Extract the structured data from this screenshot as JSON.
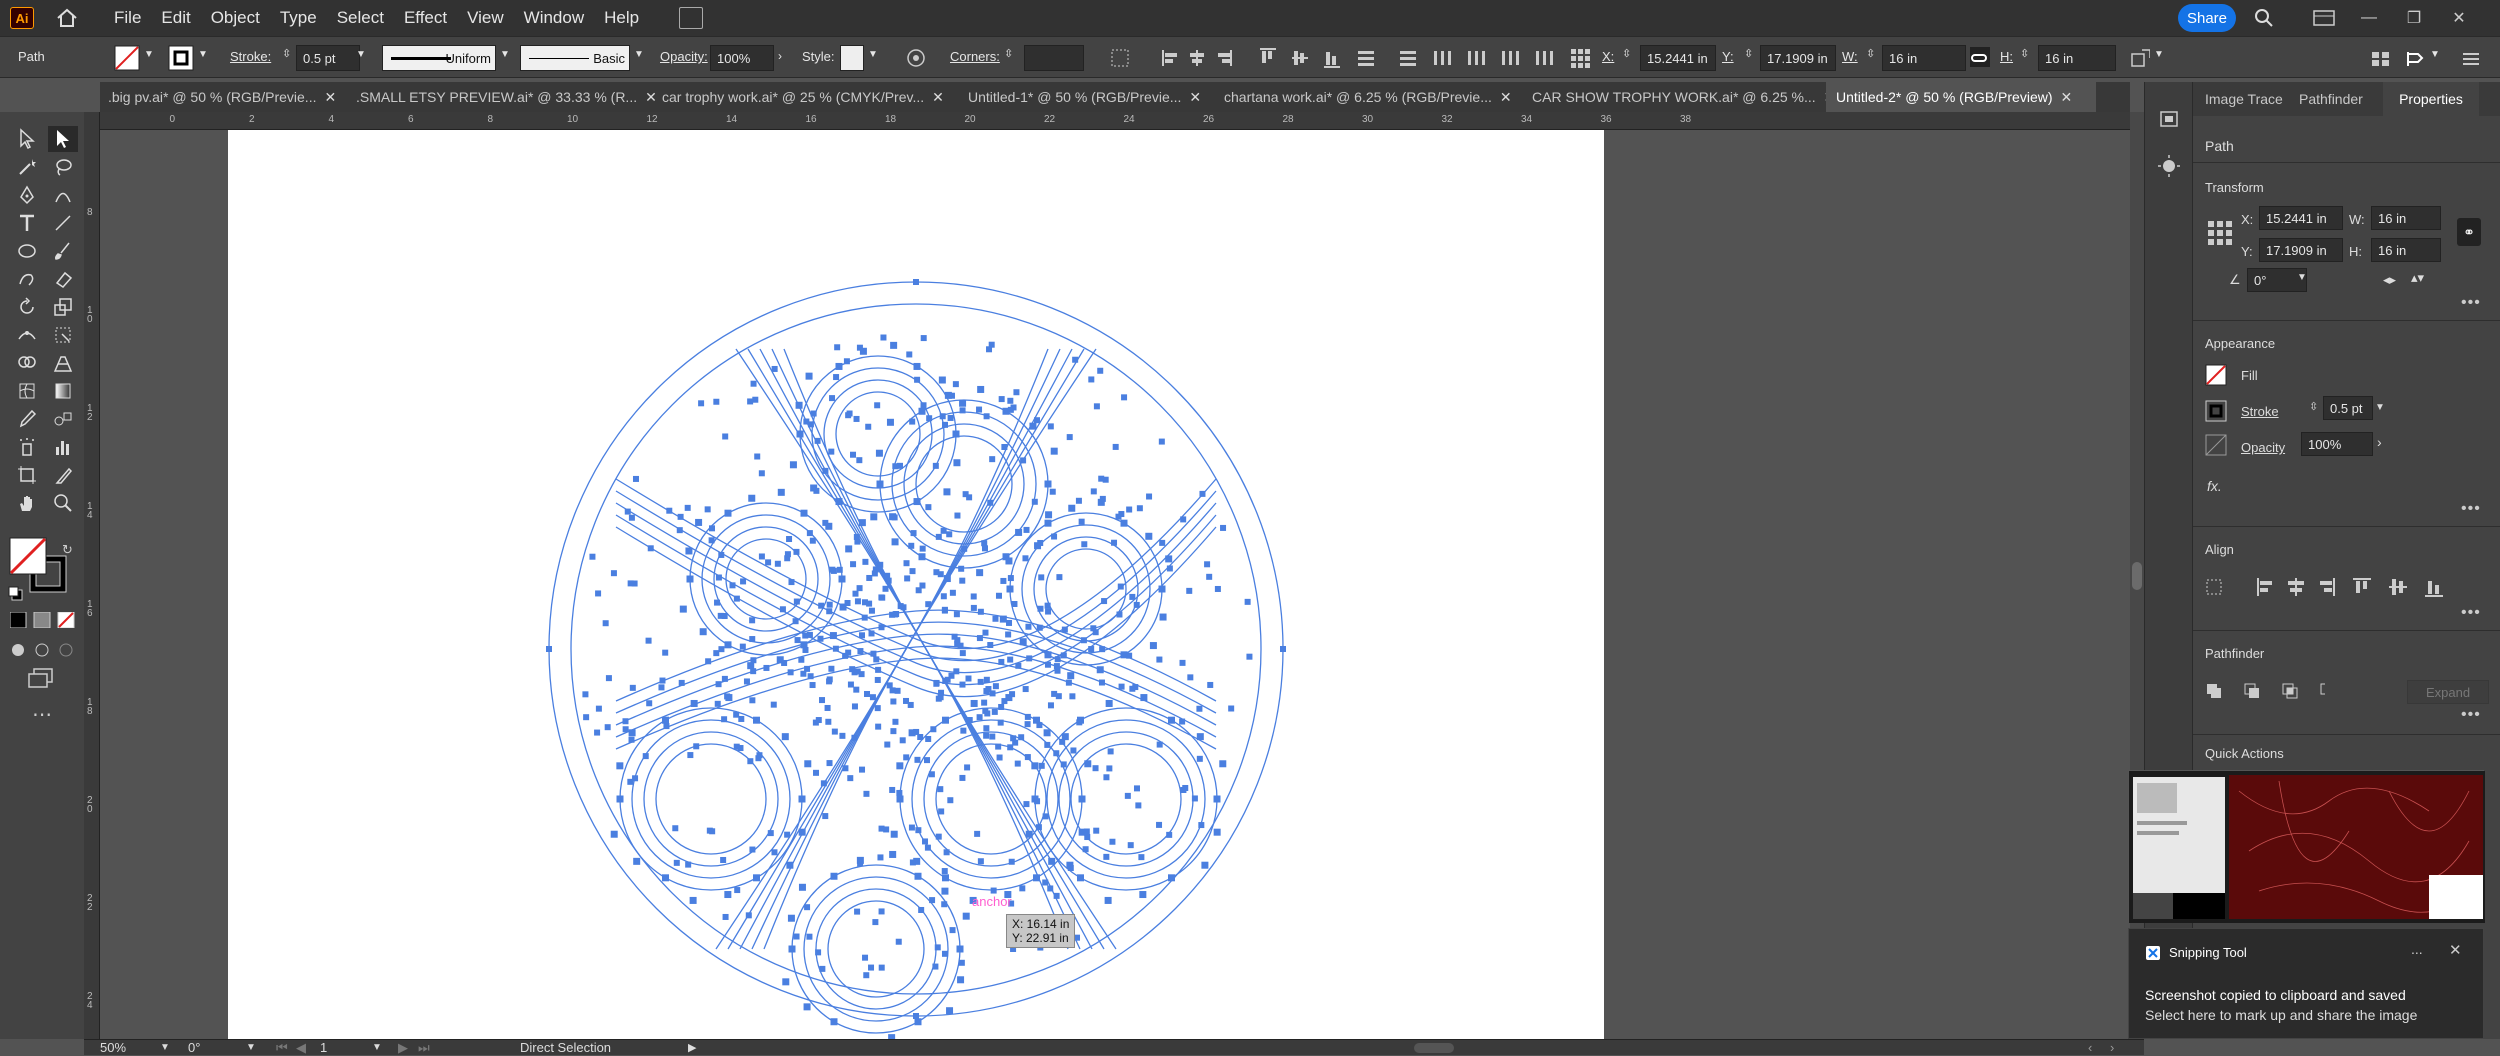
{
  "app": {
    "logo_text": "Ai",
    "share_label": "Share"
  },
  "menu": [
    "File",
    "Edit",
    "Object",
    "Type",
    "Select",
    "Effect",
    "View",
    "Window",
    "Help"
  ],
  "control": {
    "object_type": "Path",
    "stroke_label": "Stroke:",
    "stroke_weight": "0.5 pt",
    "profile_uniform": "Uniform",
    "brush_basic": "Basic",
    "opacity_label": "Opacity:",
    "opacity_value": "100%",
    "style_label": "Style:",
    "corners_label": "Corners:",
    "x_label": "X:",
    "x_value": "15.2441 in",
    "y_label": "Y:",
    "y_value": "17.1909 in",
    "w_label": "W:",
    "w_value": "16 in",
    "h_label": "H:",
    "h_value": "16 in"
  },
  "tabs": [
    {
      "label": ".big pv.ai* @ 50 % (RGB/Previe...",
      "active": false
    },
    {
      "label": ".SMALL ETSY PREVIEW.ai* @ 33.33 % (R...",
      "active": false
    },
    {
      "label": "car trophy work.ai* @ 25 % (CMYK/Prev...",
      "active": false
    },
    {
      "label": "Untitled-1* @ 50 % (RGB/Previe...",
      "active": false
    },
    {
      "label": "chartana work.ai* @ 6.25 % (RGB/Previe...",
      "active": false
    },
    {
      "label": "CAR SHOW TROPHY WORK.ai* @ 6.25 %...",
      "active": false
    },
    {
      "label": "Untitled-2* @ 50 % (RGB/Preview)",
      "active": true
    }
  ],
  "ruler": {
    "h_ticks": [
      "2",
      "0",
      "2",
      "4",
      "6",
      "8",
      "10",
      "12",
      "14",
      "16",
      "18",
      "20",
      "22",
      "24",
      "26",
      "28",
      "30",
      "32",
      "34",
      "36",
      "38"
    ],
    "v_ticks": [
      "8",
      "1 0",
      "1 2",
      "1 4",
      "1 6",
      "1 8",
      "2 0",
      "2 2",
      "2 4"
    ]
  },
  "canvas": {
    "cursor_label": "anchor",
    "tooltip_x": "X: 16.14 in",
    "tooltip_y": "Y: 22.91 in"
  },
  "panel": {
    "tabs": [
      "Image Trace",
      "Pathfinder",
      "Properties"
    ],
    "object_type": "Path",
    "transform_title": "Transform",
    "x_label": "X:",
    "x_value": "15.2441 in",
    "y_label": "Y:",
    "y_value": "17.1909 in",
    "w_label": "W:",
    "w_value": "16 in",
    "h_label": "H:",
    "h_value": "16 in",
    "angle_value": "0°",
    "appearance_title": "Appearance",
    "fill_label": "Fill",
    "stroke_label": "Stroke",
    "stroke_value": "0.5 pt",
    "opacity_label": "Opacity",
    "opacity_value": "100%",
    "fx_label": "fx.",
    "align_title": "Align",
    "pathfinder_title": "Pathfinder",
    "expand_label": "Expand",
    "quick_actions_title": "Quick Actions"
  },
  "snip": {
    "app_name": "Snipping Tool",
    "more_label": "...",
    "title": "Screenshot copied to clipboard and saved",
    "subtitle": "Select here to mark up and share the image"
  },
  "status": {
    "zoom": "50%",
    "rotation": "0°",
    "artboard": "1",
    "tool": "Direct Selection"
  },
  "colors": {
    "accent": "#1473e6",
    "path": "#4a7fe0",
    "ui_dark": "#323232",
    "ui_mid": "#434343"
  }
}
